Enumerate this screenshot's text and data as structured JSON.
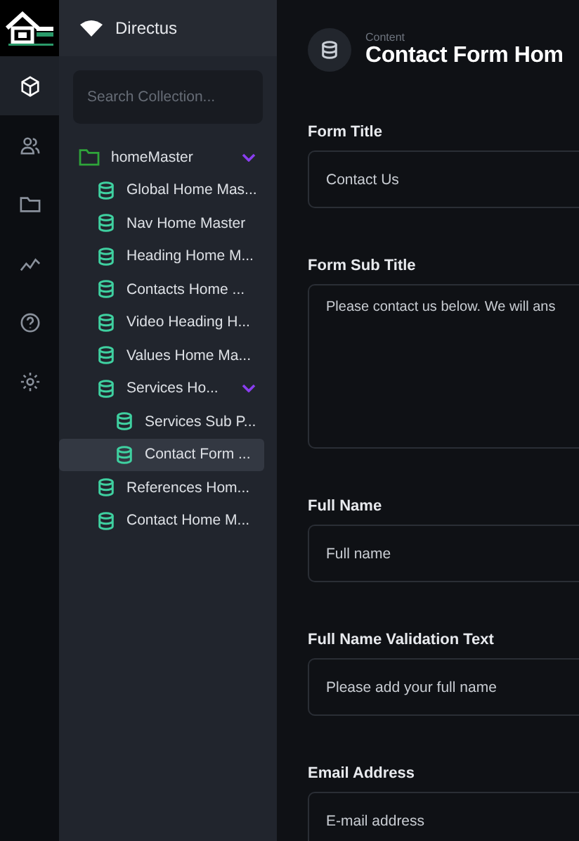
{
  "rail": {
    "items": [
      {
        "kind": "box",
        "selected": true
      },
      {
        "kind": "users",
        "selected": false
      },
      {
        "kind": "folder",
        "selected": false
      },
      {
        "kind": "chart",
        "selected": false
      },
      {
        "kind": "help",
        "selected": false
      },
      {
        "kind": "settings",
        "selected": false
      }
    ]
  },
  "sidebar": {
    "project": "Directus",
    "search": {
      "placeholder": "Search Collection..."
    },
    "tree": [
      {
        "label": "homeMaster",
        "kind": "folder",
        "expanded": true,
        "selected": false,
        "children": [
          {
            "label": "Global Home Mas...",
            "kind": "collection",
            "selected": false
          },
          {
            "label": "Nav Home Master",
            "kind": "collection",
            "selected": false
          },
          {
            "label": "Heading Home M...",
            "kind": "collection",
            "selected": false
          },
          {
            "label": "Contacts Home ...",
            "kind": "collection",
            "selected": false
          },
          {
            "label": "Video Heading H...",
            "kind": "collection",
            "selected": false
          },
          {
            "label": "Values Home Ma...",
            "kind": "collection",
            "selected": false
          },
          {
            "label": "Services Ho...",
            "kind": "collection",
            "expanded": true,
            "selected": false,
            "children": [
              {
                "label": "Services Sub P...",
                "kind": "collection",
                "selected": false
              },
              {
                "label": "Contact Form ...",
                "kind": "collection",
                "selected": true
              }
            ]
          },
          {
            "label": "References Hom...",
            "kind": "collection",
            "selected": false
          },
          {
            "label": "Contact Home M...",
            "kind": "collection",
            "selected": false
          }
        ]
      }
    ]
  },
  "header": {
    "breadcrumb": "Content",
    "title": "Contact Form Hom"
  },
  "form": [
    {
      "label": "Form Title",
      "kind": "input",
      "value": "Contact Us"
    },
    {
      "label": "Form Sub Title",
      "kind": "textarea",
      "value": "Please contact us below. We will ans"
    },
    {
      "label": "Full Name",
      "kind": "input",
      "placeholder": "Full name"
    },
    {
      "label": "Full Name Validation Text",
      "kind": "input",
      "value": "Please add your full name"
    },
    {
      "label": "Email Address",
      "kind": "input",
      "placeholder": "E-mail address"
    }
  ]
}
